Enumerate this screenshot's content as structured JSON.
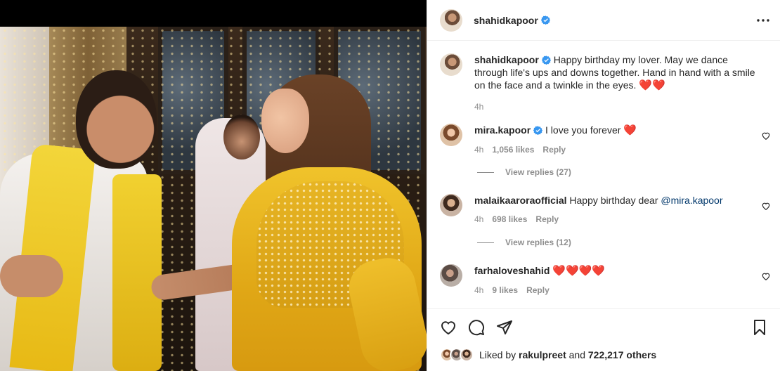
{
  "post": {
    "author": "shahidkapoor",
    "more_icon": "more-horizontal-icon"
  },
  "caption": {
    "author": "shahidkapoor",
    "text": "Happy birthday my lover. May we dance through life's ups and downs together. Hand in hand with a smile on the face and a twinkle in the eyes.",
    "emoji": "❤️❤️",
    "time": "4h"
  },
  "comments": [
    {
      "author": "mira.kapoor",
      "verified": true,
      "text": "I love you forever",
      "emoji": "❤️",
      "time": "4h",
      "likes": "1,056 likes",
      "reply_label": "Reply",
      "view_replies": "View replies (27)"
    },
    {
      "author": "malaikaaroraofficial",
      "verified": false,
      "text": "Happy birthday dear",
      "mention": "@mira.kapoor",
      "time": "4h",
      "likes": "698 likes",
      "reply_label": "Reply",
      "view_replies": "View replies (12)"
    },
    {
      "author": "farhaloveshahid",
      "verified": false,
      "emoji": "❤️❤️❤️❤️",
      "time": "4h",
      "likes": "9 likes",
      "reply_label": "Reply"
    }
  ],
  "actions": {
    "like_icon": "heart-icon",
    "comment_icon": "comment-icon",
    "share_icon": "send-icon",
    "save_icon": "bookmark-icon"
  },
  "liked_by": {
    "prefix": "Liked by",
    "user": "rakulpreet",
    "middle": "and",
    "others": "722,217 others"
  },
  "colors": {
    "verified": "#3897f0",
    "heart": "#ed2d3f",
    "mention": "#00376b",
    "secondary_text": "#8e8e8e"
  }
}
